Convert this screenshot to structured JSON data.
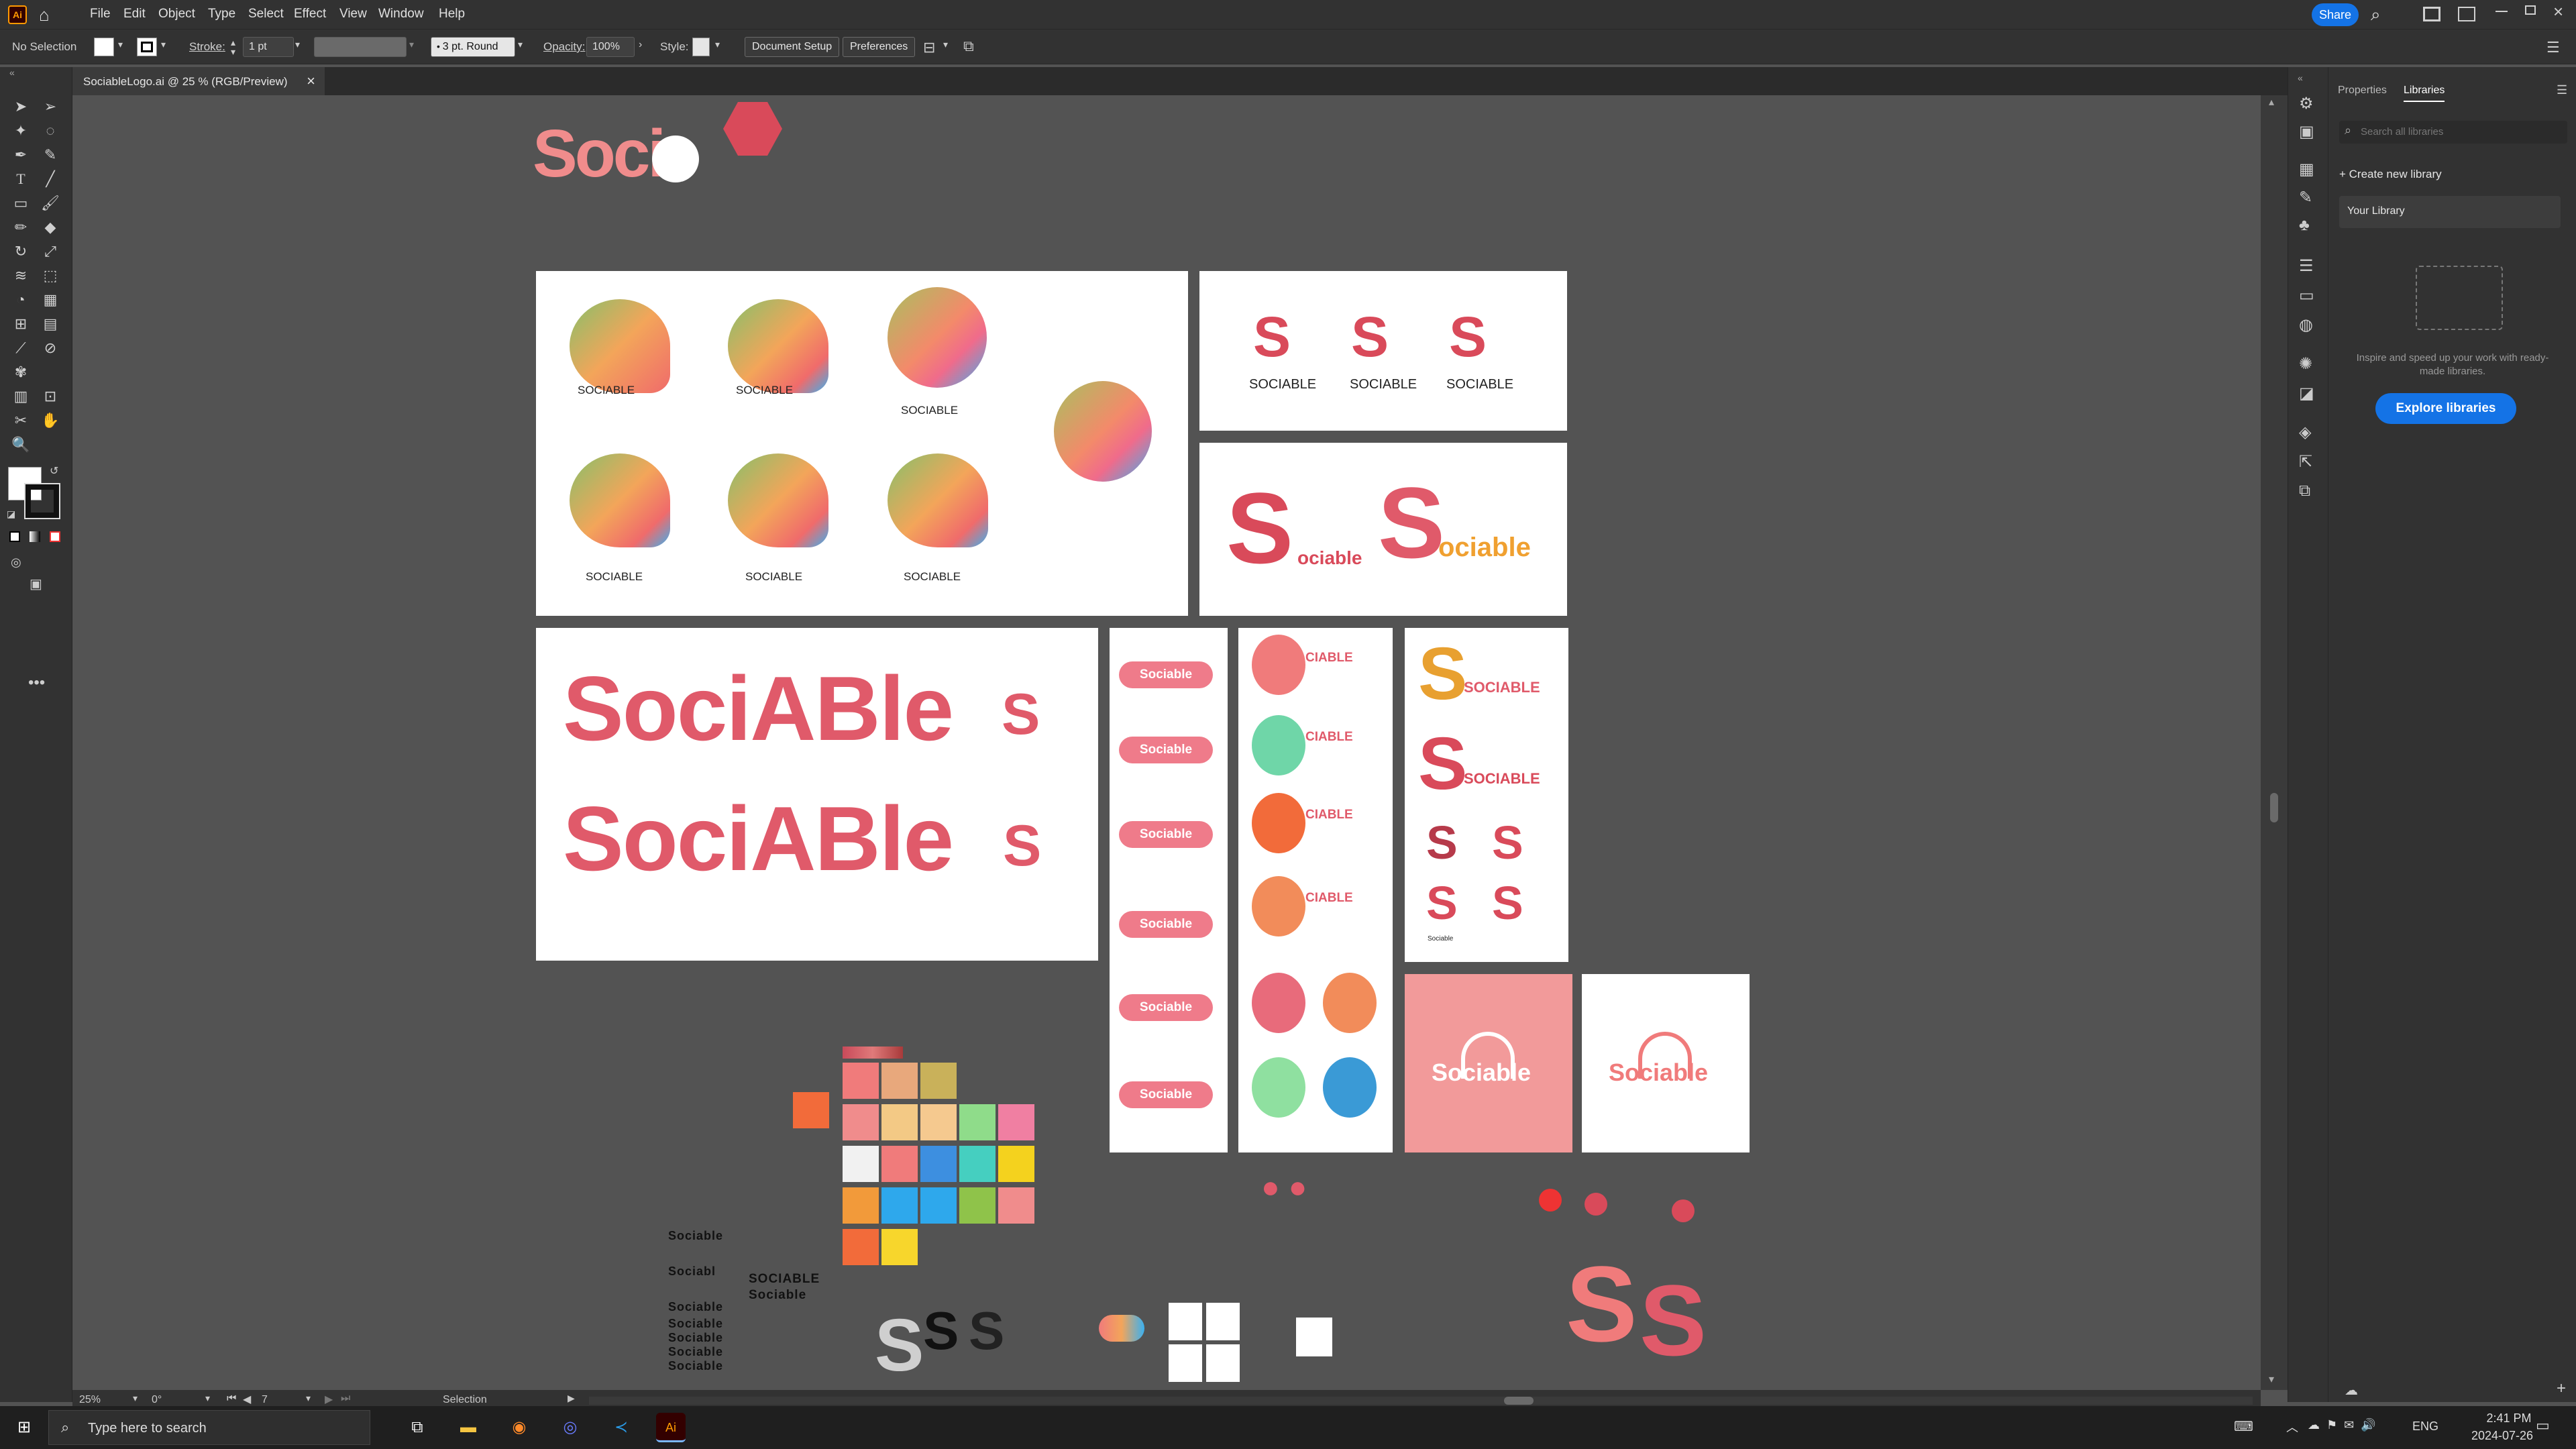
{
  "menubar": {
    "logo": "Ai",
    "items": [
      "File",
      "Edit",
      "Object",
      "Type",
      "Select",
      "Effect",
      "View",
      "Window",
      "Help"
    ],
    "share_label": "Share"
  },
  "control_bar": {
    "selection": "No Selection",
    "stroke_label": "Stroke:",
    "stroke_value": "1 pt",
    "brush": "3 pt. Round",
    "opacity_label": "Opacity:",
    "opacity_value": "100%",
    "style_label": "Style:",
    "document_setup": "Document Setup",
    "preferences": "Preferences"
  },
  "document": {
    "tab_title": "SociableLogo.ai @ 25 % (RGB/Preview)"
  },
  "artwork": {
    "wordmark_caps": "SOCIABLE",
    "wordmark_caps_lower": "Sociable",
    "wordmark_display": "SociABle",
    "wordmark_split_prefix": "S",
    "wordmark_split_suffix": "ociable",
    "wordmark_small": "ociable",
    "cable_label": "CIABLE",
    "top_partial": "Soci",
    "logo_stack": [
      "Sociable",
      "Sociabl",
      "Sociable",
      "Sociable",
      "Sociable",
      "Sociable",
      "Sociable"
    ],
    "bold_caps": "SOCIABLE",
    "bold_sub": "Sociable",
    "tiny_label": "Sociable"
  },
  "palette": [
    "#f07b7b",
    "#e8a87c",
    "#c9b15a",
    "#f08c8c",
    "#f3c985",
    "#f5c98f",
    "#8fdc8a",
    "#f07fa2",
    "#f1f1f1",
    "#f07b7b",
    "#3d8fe0",
    "#45cfc0",
    "#f4d21e",
    "#f29a3a",
    "#2ea8ec",
    "#2ea8ec",
    "#8fc34a",
    "#f08c8c",
    "#f26b3a",
    "#f7d62c"
  ],
  "status": {
    "zoom": "25%",
    "angle": "0°",
    "artboard": "7",
    "tool": "Selection"
  },
  "panel": {
    "tabs": [
      "Properties",
      "Libraries"
    ],
    "search_placeholder": "Search all libraries",
    "create_library": "Create new library",
    "your_library": "Your Library",
    "empty_text": "Inspire and speed up your work with ready-made libraries.",
    "explore_button": "Explore libraries"
  },
  "taskbar": {
    "search_placeholder": "Type here to search",
    "lang": "ENG",
    "time": "2:41 PM",
    "date": "2024-07-26"
  }
}
